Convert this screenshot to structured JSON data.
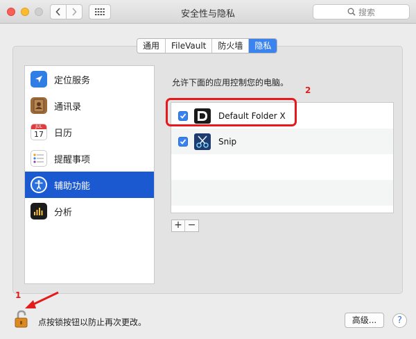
{
  "window": {
    "title": "安全性与隐私",
    "search_placeholder": "搜索"
  },
  "tabs": [
    {
      "label": "通用",
      "active": false
    },
    {
      "label": "FileVault",
      "active": false
    },
    {
      "label": "防火墙",
      "active": false
    },
    {
      "label": "隐私",
      "active": true
    }
  ],
  "sidebar": {
    "items": [
      {
        "label": "定位服务",
        "icon": "location-arrow-icon",
        "selected": false
      },
      {
        "label": "通讯录",
        "icon": "contacts-book-icon",
        "selected": false
      },
      {
        "label": "日历",
        "icon": "calendar-icon",
        "calendar_month": "JUL",
        "calendar_day": "17",
        "selected": false
      },
      {
        "label": "提醒事项",
        "icon": "reminders-icon",
        "selected": false
      },
      {
        "label": "辅助功能",
        "icon": "accessibility-icon",
        "selected": true
      },
      {
        "label": "分析",
        "icon": "analytics-icon",
        "selected": false
      }
    ]
  },
  "content": {
    "description": "允许下面的应用控制您的电脑。",
    "apps": [
      {
        "name": "Default Folder X",
        "checked": true,
        "icon": "default-folder-x-icon"
      },
      {
        "name": "Snip",
        "checked": true,
        "icon": "snip-scissors-icon"
      }
    ],
    "add_label": "+",
    "remove_label": "−"
  },
  "annotations": {
    "marker_1": "1",
    "marker_2": "2",
    "highlight_color": "#e8171b"
  },
  "footer": {
    "lock_text": "点按锁按钮以防止再次更改。",
    "advanced_button": "高级...",
    "help_button": "?"
  },
  "colors": {
    "accent": "#3b84f0",
    "selection": "#1b59d0"
  }
}
